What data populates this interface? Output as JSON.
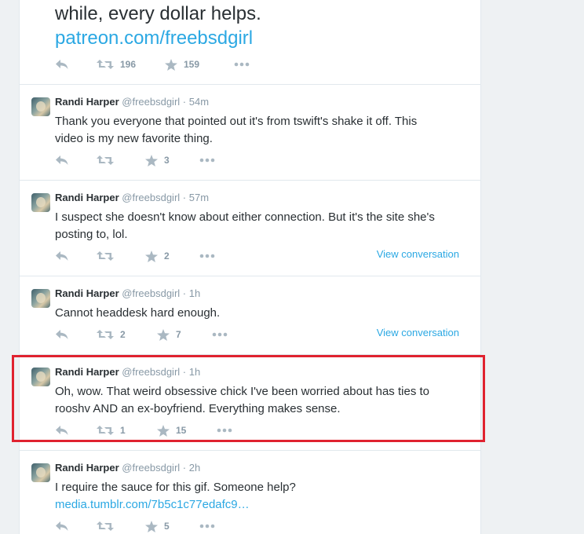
{
  "top_tweet": {
    "text": "while, every dollar helps.",
    "link": "patreon.com/freebsdgirl",
    "retweets": "196",
    "favorites": "159"
  },
  "tweets": [
    {
      "name": "Randi Harper",
      "handle": "@freebsdgirl",
      "sep": "·",
      "time": "54m",
      "line1": "Thank you everyone that pointed out it's from tswift's shake it off. This",
      "line2": "video is my new favorite thing.",
      "retweets": "",
      "favorites": "3",
      "view_conversation": ""
    },
    {
      "name": "Randi Harper",
      "handle": "@freebsdgirl",
      "sep": "·",
      "time": "57m",
      "line1": "I suspect she doesn't know about either connection. But it's the site she's",
      "line2": "posting to, lol.",
      "retweets": "",
      "favorites": "2",
      "view_conversation": "View conversation"
    },
    {
      "name": "Randi Harper",
      "handle": "@freebsdgirl",
      "sep": "·",
      "time": "1h",
      "line1": "Cannot headdesk hard enough.",
      "line2": "",
      "retweets": "2",
      "favorites": "7",
      "view_conversation": "View conversation"
    },
    {
      "name": "Randi Harper",
      "handle": "@freebsdgirl",
      "sep": "·",
      "time": "1h",
      "line1": "Oh, wow. That weird obsessive chick I've been worried about has ties to",
      "line2": "rooshv AND an ex-boyfriend. Everything makes sense.",
      "retweets": "1",
      "favorites": "15",
      "view_conversation": ""
    },
    {
      "name": "Randi Harper",
      "handle": "@freebsdgirl",
      "sep": "·",
      "time": "2h",
      "line1": "I require the sauce for this gif. Someone help?",
      "line2": "media.tumblr.com/7b5c1c77edafc9…",
      "retweets": "",
      "favorites": "5",
      "view_conversation": ""
    }
  ],
  "icons": {
    "reply": "reply-icon",
    "retweet": "retweet-icon",
    "favorite": "star-icon",
    "more": "more-icon"
  },
  "colors": {
    "link": "#2ba8e3",
    "highlight": "#e0222f",
    "icon": "#aab8c2"
  }
}
